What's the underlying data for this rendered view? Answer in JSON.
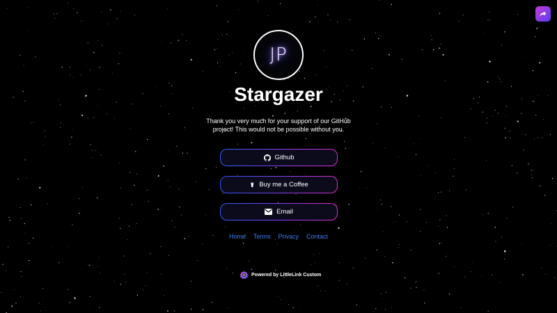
{
  "profile": {
    "initials": "JP",
    "name": "Stargazer",
    "bio": "Thank you very much for your support of our GitHub project! This would not be possible without you."
  },
  "share": {
    "icon": "share-arrow-icon"
  },
  "links": [
    {
      "label": "Github",
      "icon": "github-icon"
    },
    {
      "label": "Buy me a Coffee",
      "icon": "coffee-icon"
    },
    {
      "label": "Email",
      "icon": "envelope-icon"
    }
  ],
  "footer_nav": [
    "Home",
    "Terms",
    "Privacy",
    "Contact"
  ],
  "powered_by": {
    "label": "Powered by LittleLink Custom",
    "icon": "littlelink-logo-icon"
  },
  "colors": {
    "background": "#000000",
    "button_fill": "#0b0b1c",
    "gradient_start": "#2d5bff",
    "gradient_end": "#e02fc4",
    "footer_link": "#3d7cf0",
    "share_gradient_start": "#c53bd8",
    "share_gradient_end": "#5a3df0"
  }
}
